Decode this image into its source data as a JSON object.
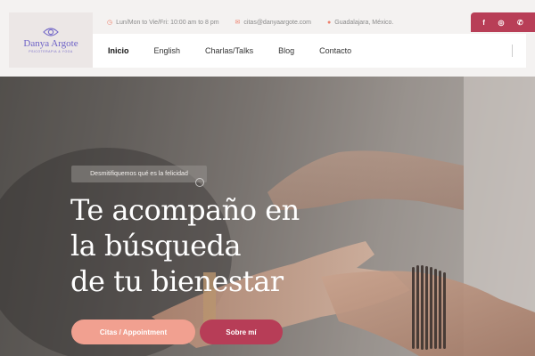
{
  "logo": {
    "name": "Danya Argote",
    "subtitle": "PSICOTERAPIA & YOGA"
  },
  "topbar": {
    "hours": "Lun/Mon to Vie/Fri: 10:00 am to 8 pm",
    "email": "citas@danyaargote.com",
    "location": "Guadalajara, México.",
    "icons": [
      "clock-icon",
      "envelope-icon",
      "map-pin-icon"
    ]
  },
  "social": {
    "icons": [
      "facebook-icon",
      "instagram-icon",
      "whatsapp-icon"
    ]
  },
  "nav": {
    "items": [
      {
        "label": "Inicio",
        "active": true
      },
      {
        "label": "English",
        "active": false
      },
      {
        "label": "Charlas/Talks",
        "active": false
      },
      {
        "label": "Blog",
        "active": false
      },
      {
        "label": "Contacto",
        "active": false
      }
    ]
  },
  "hero": {
    "tag": "Desmitifiquemos qué es la felicidad",
    "headline": [
      "Te acompaño en",
      "la búsqueda",
      "de tu bienestar"
    ],
    "buttons": {
      "primary": "Citas / Appointment",
      "secondary": "Sobre mí"
    }
  },
  "colors": {
    "accent": "#b83e57",
    "coral": "#f1a090",
    "logo": "#6d62c7"
  }
}
